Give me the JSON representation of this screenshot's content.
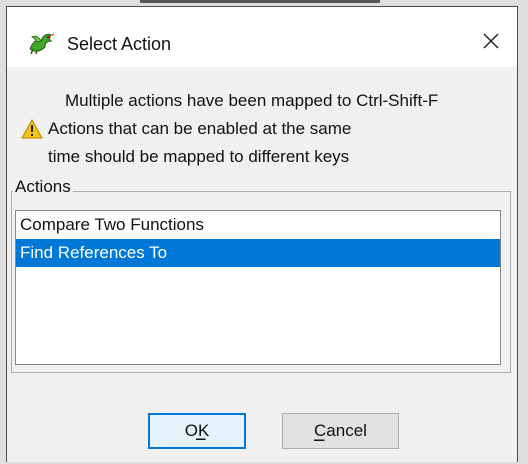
{
  "dialog": {
    "title": "Select Action",
    "icons": {
      "app": "dragon-icon",
      "close": "close-icon",
      "warning": "warning-icon"
    },
    "message": {
      "line1": "Multiple actions have been mapped to Ctrl-Shift-F",
      "line2": "Actions that can be enabled at the same",
      "line3": "time should be mapped to different keys"
    },
    "actions_group": {
      "legend": "Actions",
      "items": [
        {
          "label": "Compare Two Functions",
          "selected": false
        },
        {
          "label": "Find References To",
          "selected": true
        }
      ]
    },
    "buttons": {
      "ok": {
        "label": "OK",
        "mnemonic_index": 1
      },
      "cancel": {
        "label": "Cancel",
        "mnemonic_index": 0
      }
    }
  },
  "colors": {
    "selection": "#0078d7",
    "dialog_bg": "#f0f0f0",
    "button_bg": "#e1e1e1",
    "warning": "#f5c518"
  }
}
